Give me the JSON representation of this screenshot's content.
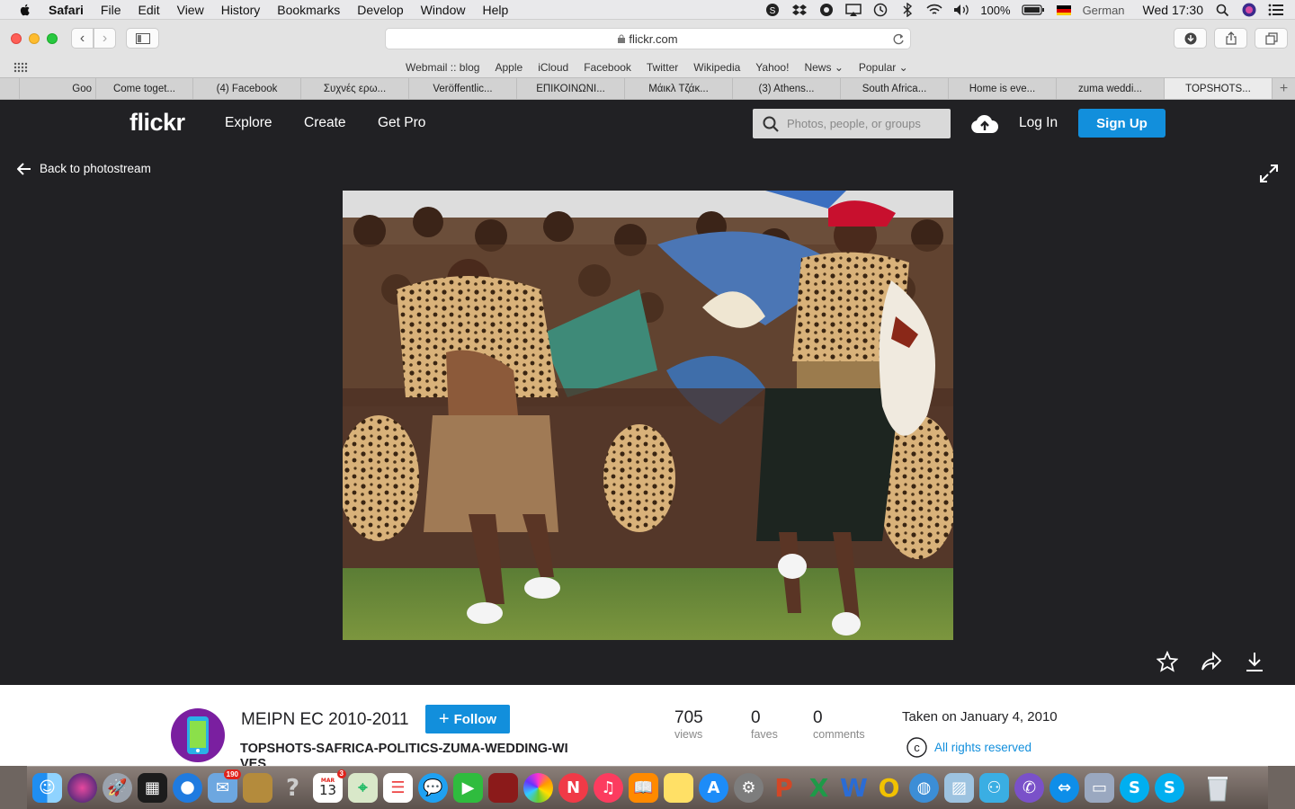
{
  "menubar": {
    "items": [
      "Safari",
      "File",
      "Edit",
      "View",
      "History",
      "Bookmarks",
      "Develop",
      "Window",
      "Help"
    ],
    "battery": "100%",
    "input_source": "German",
    "clock": "Wed 17:30"
  },
  "browser": {
    "url": "flickr.com",
    "favorites": [
      "Webmail :: blog",
      "Apple",
      "iCloud",
      "Facebook",
      "Twitter",
      "Wikipedia",
      "Yahoo!",
      "News",
      "Popular"
    ],
    "tabs": [
      "Goo",
      "Come toget...",
      "(4) Facebook",
      "Συχνές ερω...",
      "Veröffentlic...",
      "ΕΠΙΚΟΙΝΩΝΙ...",
      "Μάικλ Τζάκ...",
      "(3) Athens...",
      "South Africa...",
      "Home is eve...",
      "zuma weddi...",
      "TOPSHOTS..."
    ],
    "active_tab_index": 11
  },
  "flickr": {
    "logo": "flickr",
    "nav": [
      "Explore",
      "Create",
      "Get Pro"
    ],
    "search_placeholder": "Photos, people, or groups",
    "login": "Log In",
    "signup": "Sign Up",
    "back_label": "Back to photostream",
    "owner_name": "MEIPN EC 2010-2011",
    "follow_label": "Follow",
    "photo_title": "TOPSHOTS-SAFRICA-POLITICS-ZUMA-WEDDING-WIVES",
    "stats": [
      {
        "value": "705",
        "label": "views"
      },
      {
        "value": "0",
        "label": "faves"
      },
      {
        "value": "0",
        "label": "comments"
      }
    ],
    "taken": "Taken on January 4, 2010",
    "rights": "All rights reserved",
    "accent": "#128fdc"
  },
  "dock": {
    "mail_badge": "190",
    "calendar_badge": "3",
    "calendar_month": "MAR",
    "calendar_day": "13"
  }
}
